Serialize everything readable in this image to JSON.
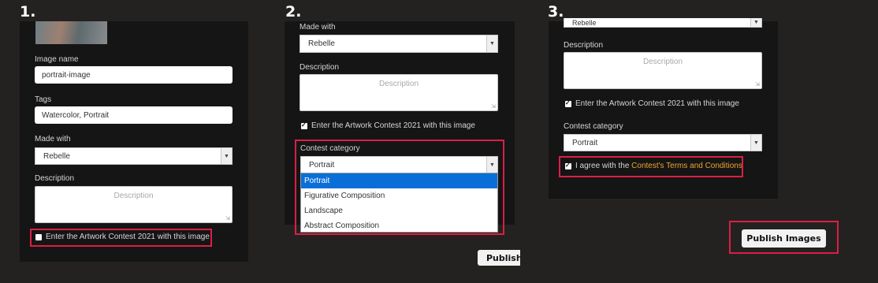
{
  "steps": [
    "1.",
    "2.",
    "3."
  ],
  "form": {
    "image_name_label": "Image name",
    "image_name_value": "portrait-image",
    "tags_label": "Tags",
    "tags_value": "Watercolor, Portrait",
    "made_with_label": "Made with",
    "made_with_value": "Rebelle",
    "description_label": "Description",
    "description_placeholder": "Description",
    "contest_checkbox_label": "Enter the Artwork Contest 2021 with this image",
    "contest_category_label": "Contest category",
    "contest_category_value": "Portrait",
    "contest_category_options": [
      "Portrait",
      "Figurative Composition",
      "Landscape",
      "Abstract Composition"
    ],
    "agree_prefix": "I agree with the ",
    "agree_link": "Contest's Terms and Conditions",
    "publish_label_partial": "Publish",
    "publish_label": "Publish Images"
  },
  "colors": {
    "background": "#242220",
    "panel": "#151515",
    "highlight": "#dc1e46",
    "link": "#f0a52a",
    "selected_option": "#0a6ed8"
  },
  "icons": {
    "dropdown": "chevron-down-icon",
    "checkbox": "checkmark-icon",
    "resize": "resize-grip-icon"
  }
}
